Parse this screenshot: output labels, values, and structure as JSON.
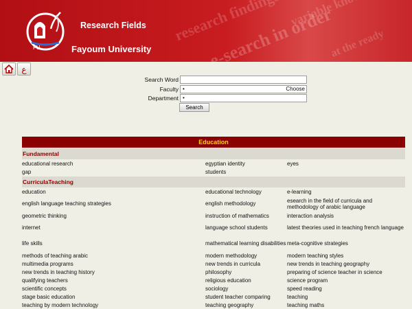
{
  "header": {
    "title": "Research Fields",
    "university": "Fayoum University"
  },
  "toolbar": {
    "home_icon": "home-icon",
    "arabic_icon": "arabic-language-icon",
    "arabic_label": "ع"
  },
  "search": {
    "word_label": "Search Word",
    "word_value": "",
    "faculty_label": "Faculty",
    "faculty_value": "•",
    "faculty_choose": "Choose",
    "department_label": "Department",
    "department_value": "•",
    "button_label": "Search"
  },
  "results": {
    "title": "Education",
    "categories": [
      {
        "name": "Fundamental",
        "rows": [
          [
            "educational research",
            "egyptian identity",
            "eyes"
          ],
          [
            "gap",
            "students",
            ""
          ]
        ]
      },
      {
        "name": "CurriculaTeaching",
        "rows": [
          [
            "education",
            "educational technology",
            "e-learning"
          ],
          [
            "english language teaching strategies",
            "english methodology",
            "esearch in the field of curricula and methodology of arabic language"
          ],
          [
            "geometric thinking",
            "instruction of mathematics",
            "interaction analysis"
          ],
          [
            "internet",
            "language school students",
            "latest theories used in teaching french language"
          ],
          [
            "life skills",
            "mathematical learning disabilities",
            "meta-cognitive strategies"
          ],
          [
            "methods of teaching arabic",
            "modern methodology",
            "modern teaching styles"
          ],
          [
            "multimedia programs",
            "new trends in curricula",
            "new trends in teaching geography"
          ],
          [
            "new trends in teaching history",
            "philosophy",
            "preparing of science teacher in science"
          ],
          [
            "qualifying teachers",
            "religious education",
            "science program"
          ],
          [
            "scientific concepts",
            "sociology",
            "speed reading"
          ],
          [
            "stage basic education",
            "student teacher comparing",
            "teaching"
          ],
          [
            "teaching by modern technology",
            "teaching geography",
            "teaching maths"
          ]
        ]
      }
    ]
  }
}
